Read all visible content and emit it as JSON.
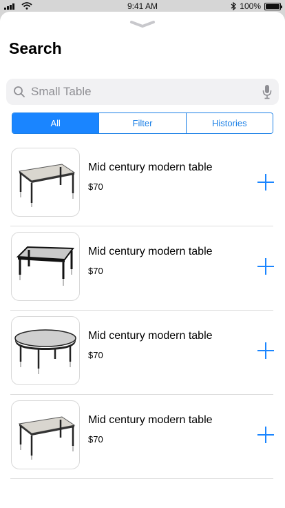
{
  "status_bar": {
    "time": "9:41 AM",
    "battery": "100%"
  },
  "page": {
    "title": "Search"
  },
  "search": {
    "placeholder": "Small Table"
  },
  "segments": [
    {
      "label": "All",
      "active": true
    },
    {
      "label": "Filter",
      "active": false
    },
    {
      "label": "Histories",
      "active": false
    }
  ],
  "products": [
    {
      "name": "Mid century modern table",
      "price": "$70",
      "image": "rectangular-table"
    },
    {
      "name": "Mid century modern table",
      "price": "$70",
      "image": "black-edge-table"
    },
    {
      "name": "Mid century modern table",
      "price": "$70",
      "image": "round-table"
    },
    {
      "name": "Mid century modern table",
      "price": "$70",
      "image": "rectangular-table"
    }
  ],
  "colors": {
    "accent": "#1a85ff",
    "segment_border": "#1a7fe6",
    "search_bg": "#f1f1f3",
    "divider": "#dcdcdc"
  },
  "icons": {
    "search": "magnifier-icon",
    "mic": "microphone-icon",
    "add": "plus-icon",
    "grabber": "chevron-down-icon"
  }
}
